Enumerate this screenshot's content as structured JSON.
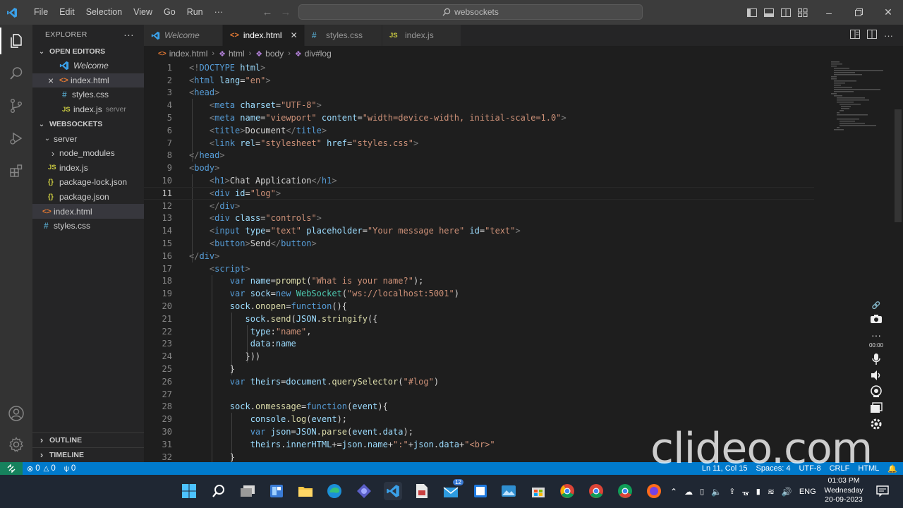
{
  "titlebar": {
    "menu": [
      "File",
      "Edit",
      "Selection",
      "View",
      "Go",
      "Run",
      "···"
    ],
    "search": "websockets"
  },
  "explorer": {
    "header": "EXPLORER",
    "open_editors_title": "OPEN EDITORS",
    "open_editors": [
      {
        "name": "Welcome",
        "type": "vscode"
      },
      {
        "name": "index.html",
        "type": "html",
        "selected": true,
        "close": "×"
      },
      {
        "name": "styles.css",
        "type": "css"
      },
      {
        "name": "index.js",
        "type": "js",
        "detail": "server"
      }
    ],
    "workspace_title": "WEBSOCKETS",
    "tree": [
      {
        "name": "server",
        "kind": "folder-open"
      },
      {
        "name": "node_modules",
        "kind": "folder"
      },
      {
        "name": "index.js",
        "kind": "js"
      },
      {
        "name": "package-lock.json",
        "kind": "json"
      },
      {
        "name": "package.json",
        "kind": "json"
      },
      {
        "name": "index.html",
        "kind": "html"
      },
      {
        "name": "styles.css",
        "kind": "css"
      }
    ],
    "outline_title": "OUTLINE",
    "timeline_title": "TIMELINE"
  },
  "tabs": [
    {
      "label": "Welcome",
      "type": "vscode"
    },
    {
      "label": "index.html",
      "type": "html",
      "active": true
    },
    {
      "label": "styles.css",
      "type": "css"
    },
    {
      "label": "index.js",
      "type": "js"
    }
  ],
  "breadcrumb": [
    "index.html",
    "html",
    "body",
    "div#log"
  ],
  "editor": {
    "current_line": 11,
    "lines": [
      {
        "n": "1",
        "code": [
          [
            "tg",
            "<!"
          ],
          [
            "tn",
            "DOCTYPE"
          ],
          [
            "at",
            " html"
          ],
          [
            "tg",
            ">"
          ]
        ]
      },
      {
        "n": "2",
        "code": [
          [
            "tg",
            "<"
          ],
          [
            "tn",
            "html"
          ],
          [
            "at",
            " lang"
          ],
          [
            "tx",
            "="
          ],
          [
            "st",
            "\"en\""
          ],
          [
            "tg",
            ">"
          ]
        ]
      },
      {
        "n": "3",
        "code": [
          [
            "tg",
            "<"
          ],
          [
            "tn",
            "head"
          ],
          [
            "tg",
            ">"
          ]
        ]
      },
      {
        "n": "4",
        "code": [
          [
            "tx",
            "    "
          ],
          [
            "tg",
            "<"
          ],
          [
            "tn",
            "meta"
          ],
          [
            "at",
            " charset"
          ],
          [
            "tx",
            "="
          ],
          [
            "st",
            "\"UTF-8\""
          ],
          [
            "tg",
            ">"
          ]
        ]
      },
      {
        "n": "5",
        "code": [
          [
            "tx",
            "    "
          ],
          [
            "tg",
            "<"
          ],
          [
            "tn",
            "meta"
          ],
          [
            "at",
            " name"
          ],
          [
            "tx",
            "="
          ],
          [
            "st",
            "\"viewport\""
          ],
          [
            "at",
            " content"
          ],
          [
            "tx",
            "="
          ],
          [
            "st",
            "\"width=device-width, initial-scale=1.0\""
          ],
          [
            "tg",
            ">"
          ]
        ]
      },
      {
        "n": "6",
        "code": [
          [
            "tx",
            "    "
          ],
          [
            "tg",
            "<"
          ],
          [
            "tn",
            "title"
          ],
          [
            "tg",
            ">"
          ],
          [
            "tx",
            "Document"
          ],
          [
            "tg",
            "</"
          ],
          [
            "tn",
            "title"
          ],
          [
            "tg",
            ">"
          ]
        ]
      },
      {
        "n": "7",
        "code": [
          [
            "tx",
            "    "
          ],
          [
            "tg",
            "<"
          ],
          [
            "tn",
            "link"
          ],
          [
            "at",
            " rel"
          ],
          [
            "tx",
            "="
          ],
          [
            "st",
            "\"stylesheet\""
          ],
          [
            "at",
            " href"
          ],
          [
            "tx",
            "="
          ],
          [
            "st",
            "\"styles.css\""
          ],
          [
            "tg",
            ">"
          ]
        ]
      },
      {
        "n": "8",
        "code": [
          [
            "tg",
            "</"
          ],
          [
            "tn",
            "head"
          ],
          [
            "tg",
            ">"
          ]
        ]
      },
      {
        "n": "9",
        "code": [
          [
            "tg",
            "<"
          ],
          [
            "tn",
            "body"
          ],
          [
            "tg",
            ">"
          ]
        ]
      },
      {
        "n": "10",
        "code": [
          [
            "tx",
            "    "
          ],
          [
            "tg",
            "<"
          ],
          [
            "tn",
            "h1"
          ],
          [
            "tg",
            ">"
          ],
          [
            "tx",
            "Chat Application"
          ],
          [
            "tg",
            "</"
          ],
          [
            "tn",
            "h1"
          ],
          [
            "tg",
            ">"
          ]
        ]
      },
      {
        "n": "11",
        "code": [
          [
            "tx",
            "    "
          ],
          [
            "tg",
            "<"
          ],
          [
            "tn",
            "div"
          ],
          [
            "at",
            " id"
          ],
          [
            "tx",
            "="
          ],
          [
            "st",
            "\"log\""
          ],
          [
            "tg",
            ">"
          ]
        ]
      },
      {
        "n": "12",
        "code": [
          [
            "tx",
            "    "
          ],
          [
            "tg",
            "</"
          ],
          [
            "tn",
            "div"
          ],
          [
            "tg",
            ">"
          ]
        ]
      },
      {
        "n": "13",
        "code": [
          [
            "tx",
            "    "
          ],
          [
            "tg",
            "<"
          ],
          [
            "tn",
            "div"
          ],
          [
            "at",
            " class"
          ],
          [
            "tx",
            "="
          ],
          [
            "st",
            "\"controls\""
          ],
          [
            "tg",
            ">"
          ]
        ]
      },
      {
        "n": "14",
        "code": [
          [
            "tx",
            "    "
          ],
          [
            "tg",
            "<"
          ],
          [
            "tn",
            "input"
          ],
          [
            "at",
            " type"
          ],
          [
            "tx",
            "="
          ],
          [
            "st",
            "\"text\""
          ],
          [
            "at",
            " placeholder"
          ],
          [
            "tx",
            "="
          ],
          [
            "st",
            "\"Your message here\""
          ],
          [
            "at",
            " id"
          ],
          [
            "tx",
            "="
          ],
          [
            "st",
            "\"text\""
          ],
          [
            "tg",
            ">"
          ]
        ]
      },
      {
        "n": "15",
        "code": [
          [
            "tx",
            "    "
          ],
          [
            "tg",
            "<"
          ],
          [
            "tn",
            "button"
          ],
          [
            "tg",
            ">"
          ],
          [
            "tx",
            "Send"
          ],
          [
            "tg",
            "</"
          ],
          [
            "tn",
            "button"
          ],
          [
            "tg",
            ">"
          ]
        ]
      },
      {
        "n": "16",
        "code": [
          [
            "tg",
            "</"
          ],
          [
            "tn",
            "div"
          ],
          [
            "tg",
            ">"
          ]
        ]
      },
      {
        "n": "17",
        "code": [
          [
            "tx",
            "    "
          ],
          [
            "tg",
            "<"
          ],
          [
            "tn",
            "script"
          ],
          [
            "tg",
            ">"
          ]
        ]
      },
      {
        "n": "18",
        "code": [
          [
            "tx",
            "        "
          ],
          [
            "kw",
            "var"
          ],
          [
            "vr",
            " name"
          ],
          [
            "tx",
            "="
          ],
          [
            "fn",
            "prompt"
          ],
          [
            "tx",
            "("
          ],
          [
            "st",
            "\"What is your name?\""
          ],
          [
            "tx",
            ");"
          ]
        ]
      },
      {
        "n": "19",
        "code": [
          [
            "tx",
            "        "
          ],
          [
            "kw",
            "var"
          ],
          [
            "vr",
            " sock"
          ],
          [
            "tx",
            "="
          ],
          [
            "kw",
            "new"
          ],
          [
            "cl",
            " WebSocket"
          ],
          [
            "tx",
            "("
          ],
          [
            "st",
            "\"ws://localhost:5001\""
          ],
          [
            "tx",
            ")"
          ]
        ]
      },
      {
        "n": "20",
        "code": [
          [
            "tx",
            "        "
          ],
          [
            "vr",
            "sock"
          ],
          [
            "tx",
            "."
          ],
          [
            "fn",
            "onopen"
          ],
          [
            "tx",
            "="
          ],
          [
            "kw",
            "function"
          ],
          [
            "tx",
            "(){"
          ]
        ]
      },
      {
        "n": "21",
        "code": [
          [
            "tx",
            "           "
          ],
          [
            "vr",
            "sock"
          ],
          [
            "tx",
            "."
          ],
          [
            "fn",
            "send"
          ],
          [
            "tx",
            "("
          ],
          [
            "vr",
            "JSON"
          ],
          [
            "tx",
            "."
          ],
          [
            "fn",
            "stringify"
          ],
          [
            "tx",
            "({"
          ]
        ]
      },
      {
        "n": "22",
        "code": [
          [
            "tx",
            "            "
          ],
          [
            "vr",
            "type"
          ],
          [
            "tx",
            ":"
          ],
          [
            "st",
            "\"name\""
          ],
          [
            "tx",
            ","
          ]
        ]
      },
      {
        "n": "23",
        "code": [
          [
            "tx",
            "            "
          ],
          [
            "vr",
            "data"
          ],
          [
            "tx",
            ":"
          ],
          [
            "vr",
            "name"
          ]
        ]
      },
      {
        "n": "24",
        "code": [
          [
            "tx",
            "           }))"
          ]
        ]
      },
      {
        "n": "25",
        "code": [
          [
            "tx",
            "        }"
          ]
        ]
      },
      {
        "n": "26",
        "code": [
          [
            "tx",
            "        "
          ],
          [
            "kw",
            "var"
          ],
          [
            "vr",
            " theirs"
          ],
          [
            "tx",
            "="
          ],
          [
            "vr",
            "document"
          ],
          [
            "tx",
            "."
          ],
          [
            "fn",
            "querySelector"
          ],
          [
            "tx",
            "("
          ],
          [
            "st",
            "\"#log\""
          ],
          [
            "tx",
            ")"
          ]
        ]
      },
      {
        "n": "27",
        "code": []
      },
      {
        "n": "28",
        "code": [
          [
            "tx",
            "        "
          ],
          [
            "vr",
            "sock"
          ],
          [
            "tx",
            "."
          ],
          [
            "fn",
            "onmessage"
          ],
          [
            "tx",
            "="
          ],
          [
            "kw",
            "function"
          ],
          [
            "tx",
            "("
          ],
          [
            "vr",
            "event"
          ],
          [
            "tx",
            "){"
          ]
        ]
      },
      {
        "n": "29",
        "code": [
          [
            "tx",
            "            "
          ],
          [
            "vr",
            "console"
          ],
          [
            "tx",
            "."
          ],
          [
            "fn",
            "log"
          ],
          [
            "tx",
            "("
          ],
          [
            "vr",
            "event"
          ],
          [
            "tx",
            ");"
          ]
        ]
      },
      {
        "n": "30",
        "code": [
          [
            "tx",
            "            "
          ],
          [
            "kw",
            "var"
          ],
          [
            "vr",
            " json"
          ],
          [
            "tx",
            "="
          ],
          [
            "vr",
            "JSON"
          ],
          [
            "tx",
            "."
          ],
          [
            "fn",
            "parse"
          ],
          [
            "tx",
            "("
          ],
          [
            "vr",
            "event"
          ],
          [
            "tx",
            "."
          ],
          [
            "vr",
            "data"
          ],
          [
            "tx",
            ");"
          ]
        ]
      },
      {
        "n": "31",
        "code": [
          [
            "tx",
            "            "
          ],
          [
            "vr",
            "theirs"
          ],
          [
            "tx",
            "."
          ],
          [
            "vr",
            "innerHTML"
          ],
          [
            "tx",
            "+="
          ],
          [
            "vr",
            "json"
          ],
          [
            "tx",
            "."
          ],
          [
            "vr",
            "name"
          ],
          [
            "tx",
            "+"
          ],
          [
            "st",
            "\":\""
          ],
          [
            "tx",
            "+"
          ],
          [
            "vr",
            "json"
          ],
          [
            "tx",
            "."
          ],
          [
            "vr",
            "data"
          ],
          [
            "tx",
            "+"
          ],
          [
            "st",
            "\"<br>\""
          ]
        ]
      },
      {
        "n": "32",
        "code": [
          [
            "tx",
            "        }"
          ]
        ]
      }
    ]
  },
  "recorder": {
    "time": "00:00"
  },
  "statusbar": {
    "errors": "0",
    "warnings": "0",
    "ports": "0",
    "right": [
      "Ln 11, Col 15",
      "Spaces: 4",
      "UTF-8",
      "CRLF",
      "HTML"
    ]
  },
  "watermark": "clideo.com",
  "taskbar": {
    "tray_lang": "ENG",
    "time": "01:03 PM",
    "day": "Wednesday",
    "date": "20-09-2023",
    "mail_badge": "12"
  },
  "colors": {
    "statusbar": "#007acc",
    "activitybar": "#333333",
    "sidebar": "#252526",
    "editor": "#1e1e1e",
    "titlebar": "#3c3c3c",
    "taskbar": "#1f2733"
  }
}
